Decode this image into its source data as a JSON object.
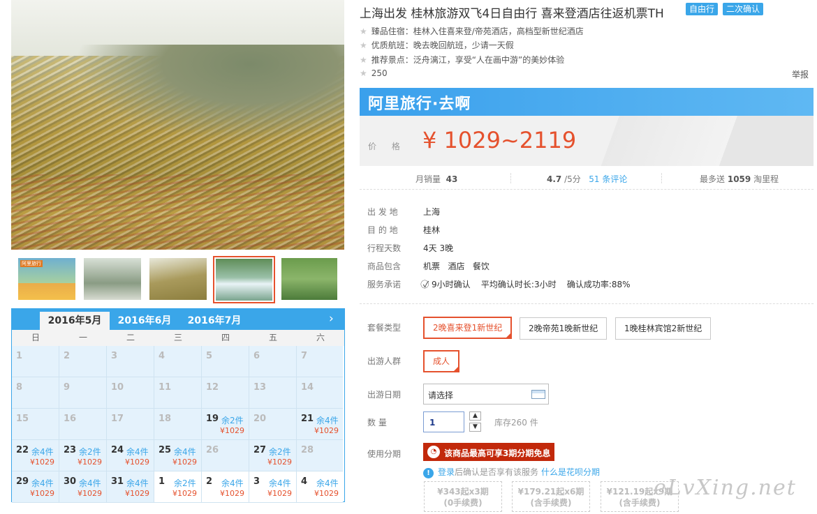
{
  "title": "上海出发 桂林旅游双飞4日自由行 喜来登酒店往返机票TH",
  "tags": [
    "自由行",
    "二次确认"
  ],
  "features": [
    "臻品住宿：桂林入住喜来登/帝苑酒店，高档型新世纪酒店",
    "优质航班：晚去晚回航班，少请一天假",
    "推荐景点：泛舟漓江，享受“人在画中游”的美妙体验",
    "250"
  ],
  "report_label": "举报",
  "banner_text": "阿里旅行·去啊",
  "price": {
    "label": "价 格",
    "value": "¥ 1029~2119"
  },
  "stats": {
    "monthly_sales_label": "月销量",
    "monthly_sales": "43",
    "rating": "4.7",
    "rating_max": "/5分",
    "reviews": "51 条评论",
    "miles_prefix": "最多送",
    "miles": "1059",
    "miles_suffix": "淘里程"
  },
  "info": [
    {
      "label": "出 发 地",
      "value": "上海"
    },
    {
      "label": "目 的 地",
      "value": "桂林"
    },
    {
      "label": "行程天数",
      "value": "4天 3晚"
    },
    {
      "label": "商品包含",
      "value": "机票   酒店   餐饮"
    },
    {
      "label": "服务承诺",
      "value": "9小时确认    平均确认时长:3小时    确认成功率:88%"
    }
  ],
  "package": {
    "label": "套餐类型",
    "options": [
      "2晚喜来登1新世纪",
      "2晚帝苑1晚新世纪",
      "1晚桂林宾馆2新世纪"
    ],
    "selected": 0
  },
  "travelers": {
    "label": "出游人群",
    "options": [
      "成人"
    ],
    "selected": 0
  },
  "date": {
    "label": "出游日期",
    "value": "请选择"
  },
  "quantity": {
    "label": "数 量",
    "value": "1",
    "stock": "库存260 件"
  },
  "installment": {
    "label": "使用分期",
    "button": "该商品最高可享3期分期免息",
    "note_login": "登录",
    "note_mid": "后确认是否享有该服务",
    "note_link": "什么是花呗分期",
    "plans": [
      {
        "line1": "¥343起x3期",
        "line2": "(0手续费)"
      },
      {
        "line1": "¥179.21起x6期",
        "line2": "(含手续费)"
      },
      {
        "line1": "¥121.19起x9期",
        "line2": "(含手续费)"
      }
    ]
  },
  "watermark": "eLvXing.net",
  "thumbnail_label": "阿里旅行",
  "calendar": {
    "months": [
      "2016年5月",
      "2016年6月",
      "2016年7月"
    ],
    "active_month": 0,
    "weekdays": [
      "日",
      "一",
      "二",
      "三",
      "四",
      "五",
      "六"
    ],
    "weeks": [
      [
        {
          "d": "1",
          "g": true
        },
        {
          "d": "2",
          "g": true
        },
        {
          "d": "3",
          "g": true
        },
        {
          "d": "4",
          "g": true
        },
        {
          "d": "5",
          "g": true
        },
        {
          "d": "6",
          "g": true
        },
        {
          "d": "7",
          "g": true
        }
      ],
      [
        {
          "d": "8",
          "g": true
        },
        {
          "d": "9",
          "g": true
        },
        {
          "d": "10",
          "g": true
        },
        {
          "d": "11",
          "g": true
        },
        {
          "d": "12",
          "g": true
        },
        {
          "d": "13",
          "g": true
        },
        {
          "d": "14",
          "g": true
        }
      ],
      [
        {
          "d": "15",
          "g": true
        },
        {
          "d": "16",
          "g": true
        },
        {
          "d": "17",
          "g": true
        },
        {
          "d": "18",
          "g": true
        },
        {
          "d": "19",
          "s": "余2件",
          "p": "¥1029"
        },
        {
          "d": "20",
          "g": true
        },
        {
          "d": "21",
          "s": "余4件",
          "p": "¥1029"
        }
      ],
      [
        {
          "d": "22",
          "s": "余4件",
          "p": "¥1029"
        },
        {
          "d": "23",
          "s": "余2件",
          "p": "¥1029"
        },
        {
          "d": "24",
          "s": "余4件",
          "p": "¥1029"
        },
        {
          "d": "25",
          "s": "余4件",
          "p": "¥1029"
        },
        {
          "d": "26",
          "g": true
        },
        {
          "d": "27",
          "s": "余2件",
          "p": "¥1029"
        },
        {
          "d": "28",
          "g": true
        }
      ],
      [
        {
          "d": "29",
          "s": "余4件",
          "p": "¥1029"
        },
        {
          "d": "30",
          "s": "余4件",
          "p": "¥1029"
        },
        {
          "d": "31",
          "s": "余4件",
          "p": "¥1029"
        },
        {
          "d": "1",
          "s": "余2件",
          "p": "¥1029",
          "w": true
        },
        {
          "d": "2",
          "s": "余4件",
          "p": "¥1029",
          "w": true
        },
        {
          "d": "3",
          "s": "余4件",
          "p": "¥1029",
          "w": true
        },
        {
          "d": "4",
          "s": "余4件",
          "p": "¥1029",
          "w": true
        }
      ]
    ]
  },
  "colors": {
    "accent": "#3aa6e9",
    "price": "#e5512d",
    "install": "#c2290b"
  }
}
